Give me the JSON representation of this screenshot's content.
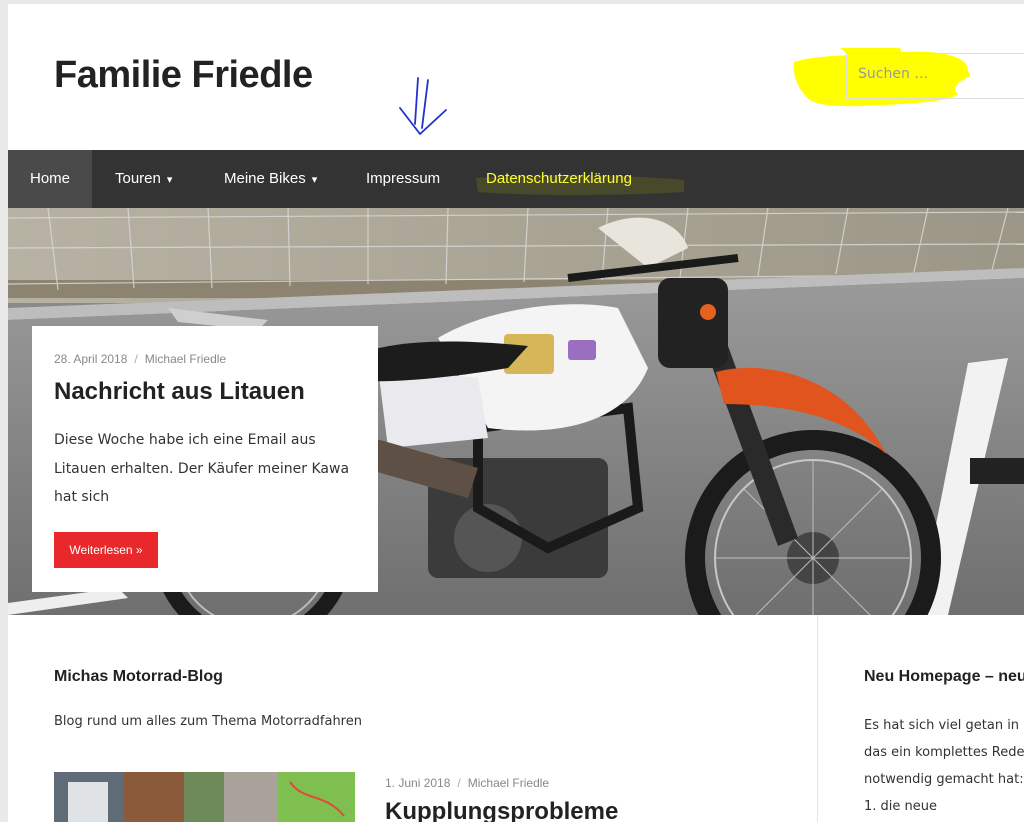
{
  "header": {
    "site_title": "Familie Friedle",
    "search": {
      "placeholder": "Suchen …"
    }
  },
  "annotations": {
    "arrow_color": "#2233cc",
    "highlight_color": "#ffff00"
  },
  "nav": {
    "items": [
      {
        "label": "Home",
        "active": true
      },
      {
        "label": "Touren",
        "dropdown": true
      },
      {
        "label": "Meine Bikes",
        "dropdown": true
      },
      {
        "label": "Impressum"
      },
      {
        "label": "Datenschutzerklärung",
        "highlighted": true
      }
    ]
  },
  "featured": {
    "date": "28. April 2018",
    "author": "Michael Friedle",
    "title": "Nachricht aus Litauen",
    "excerpt_lines": [
      "Diese Woche habe ich eine Email aus",
      "Litauen erhalten. Der Käufer meiner Kawa",
      "hat sich"
    ],
    "button": "Weiterlesen »"
  },
  "blog": {
    "title": "Michas Motorrad-Blog",
    "description": "Blog rund um alles zum Thema Motorradfahren"
  },
  "post": {
    "date": "1. Juni 2018",
    "author": "Michael Friedle",
    "title": "Kupplungsprobleme"
  },
  "sidebar": {
    "title": "Neu Homepage – neu",
    "lines": [
      "Es hat sich viel getan in I",
      "das ein komplettes Rede",
      "notwendig gemacht hat:",
      "1. die neue"
    ]
  },
  "colors": {
    "nav_bg": "#333333",
    "accent_button": "#e8282b",
    "nav_highlight_text": "#ffff35"
  }
}
